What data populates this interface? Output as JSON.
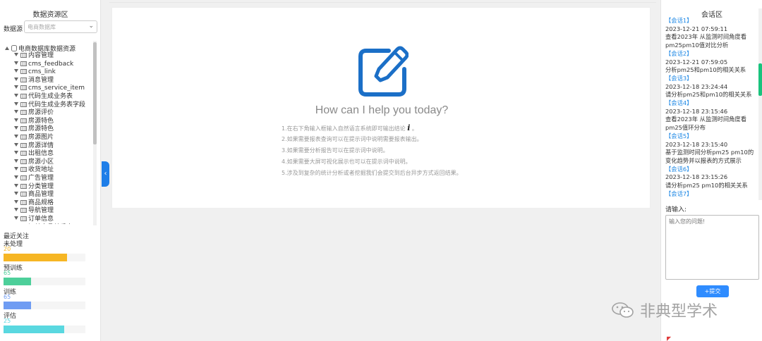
{
  "left_panel": {
    "title": "数据资源区",
    "datasource_label": "数据源",
    "datasource_value": "电商数据库",
    "tree_root": "电商数据库数据资源",
    "tree_items": [
      "内容管理",
      "cms_feedback",
      "cms_link",
      "消息管理",
      "cms_service_item",
      "代码生成业务表",
      "代码生成业务表字段",
      "房源评价",
      "房源特色",
      "房源特色",
      "房源图片",
      "房源详情",
      "出租信息",
      "房源小区",
      "收货地址",
      "广告管理",
      "分类管理",
      "商品管理",
      "商品规格",
      "导航管理",
      "订单信息",
      "订单商品关系表"
    ],
    "recent_title": "最近关注",
    "stats": [
      {
        "label": "未处理",
        "value": "20",
        "fraction": 0.78,
        "color": "#f6b624"
      },
      {
        "label": "预训练",
        "value": "65",
        "fraction": 0.34,
        "color": "#4dcf9a"
      },
      {
        "label": "训练",
        "value": "65",
        "fraction": 0.34,
        "color": "#6f9cf3"
      },
      {
        "label": "评估",
        "value": "25",
        "fraction": 0.74,
        "color": "#5ad8e0"
      }
    ]
  },
  "main": {
    "welcome": "How can I help you today?",
    "tips": [
      "1.在右下角输入框输入自然语言系统即可输出结论",
      "2.如果需要报表查询可以在提示词中说明需要报表输出。",
      "3.如果需要分析报告可以在提示词中说明。",
      "4.如果需要大屏可视化展示也可以在提示词中说明。",
      "5.涉及到复杂的统计分析或者挖掘我们会提交到后台异步方式返回结果。"
    ],
    "info_glyph": "i",
    "tip1_suffix": "。"
  },
  "right_panel": {
    "title": "会话区",
    "sessions": [
      {
        "name": "【会话1】",
        "time": "2023-12-21 07:59:11",
        "text": [
          "查看2023年 从监测时间角度看",
          "pm25pm10值对比分析"
        ]
      },
      {
        "name": "【会话2】",
        "time": "2023-12-21 07:59:05",
        "text": [
          "分析pm25和pm10的相关关系"
        ]
      },
      {
        "name": "【会话3】",
        "time": "2023-12-18 23:24:44",
        "text": [
          "请分析pm25和pm10的相关关系"
        ]
      },
      {
        "name": "【会话4】",
        "time": "2023-12-18 23:15:46",
        "text": [
          "查看2023年 从监测时间角度看",
          "pm25值环分布"
        ]
      },
      {
        "name": "【会话5】",
        "time": "2023-12-18 23:15:40",
        "text": [
          "基于监测时间分析pm25 pm10的",
          "变化趋势并以报表的方式展示"
        ]
      },
      {
        "name": "【会话6】",
        "time": "2023-12-18 23:15:26",
        "text": [
          "请分析pm25 pm10的相关关系"
        ]
      },
      {
        "name": "【会话7】",
        "time": "",
        "text": []
      }
    ],
    "input_label": "请输入:",
    "input_placeholder": "输入您的问题!",
    "submit_label": "+提交"
  },
  "watermark": {
    "text": "非典型学术"
  },
  "colors": {
    "accent": "#1e7ee8",
    "session_link": "#1e88e5",
    "icon_blue": "#1b6fc7"
  }
}
